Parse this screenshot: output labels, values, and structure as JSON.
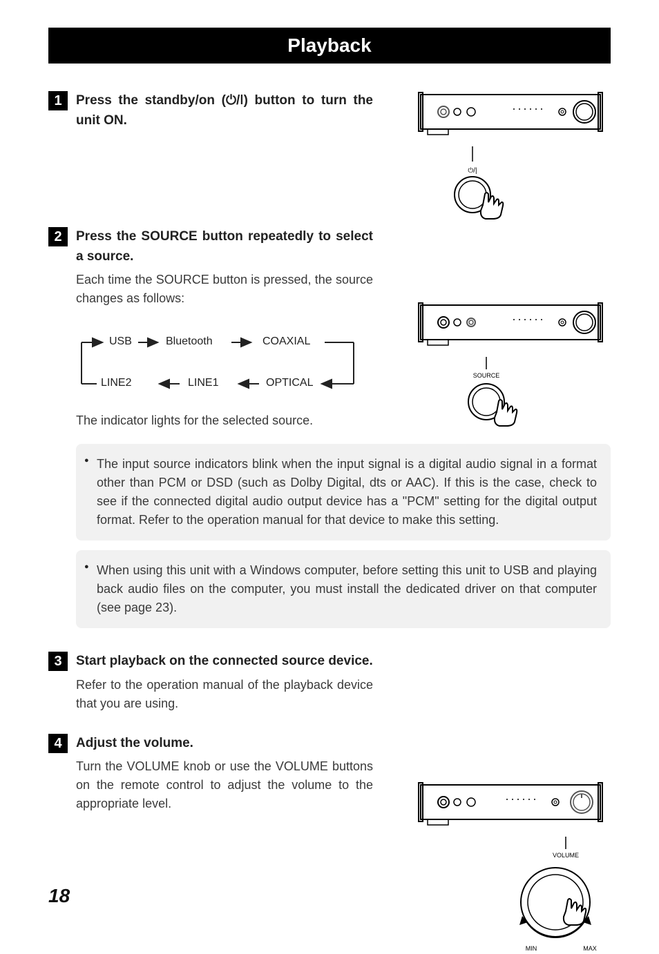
{
  "title": "Playback",
  "steps": {
    "s1": {
      "num": "1",
      "heading_pre": "Press the standby/on (",
      "heading_post": ") button to turn the unit ON."
    },
    "s2": {
      "num": "2",
      "heading": "Press the SOURCE button repeatedly to select a source.",
      "text": "Each time the SOURCE button is pressed, the source changes as follows:",
      "flow": {
        "usb": "USB",
        "bt": "Bluetooth",
        "coax": "COAXIAL",
        "line2": "LINE2",
        "line1": "LINE1",
        "opt": "OPTICAL"
      },
      "after": "The indicator lights for the selected source."
    },
    "s3": {
      "num": "3",
      "heading": "Start playback on the connected source device.",
      "text": "Refer to the operation manual of the playback device that you are using."
    },
    "s4": {
      "num": "4",
      "heading": "Adjust the volume.",
      "text": "Turn the VOLUME knob or use the VOLUME buttons on the remote control to adjust the volume to the appropriate level."
    }
  },
  "notes": {
    "n1": "The input source indicators blink when the input signal is a digital audio signal in a format other than PCM or DSD (such as Dolby Digital, dts or AAC). If this is the case, check to see if the connected digital audio output device has a \"PCM\" setting for the digital output format. Refer to the operation manual for that device to make this setting.",
    "n2": "When using this unit with a Windows computer, before setting this unit to USB and playing back audio files on the computer, you must install the dedicated driver on that computer (see page 23)."
  },
  "labels": {
    "source": "SOURCE",
    "volume": "VOLUME",
    "min": "MIN",
    "max": "MAX",
    "power_sym": "⏻/|"
  },
  "page_number": "18"
}
